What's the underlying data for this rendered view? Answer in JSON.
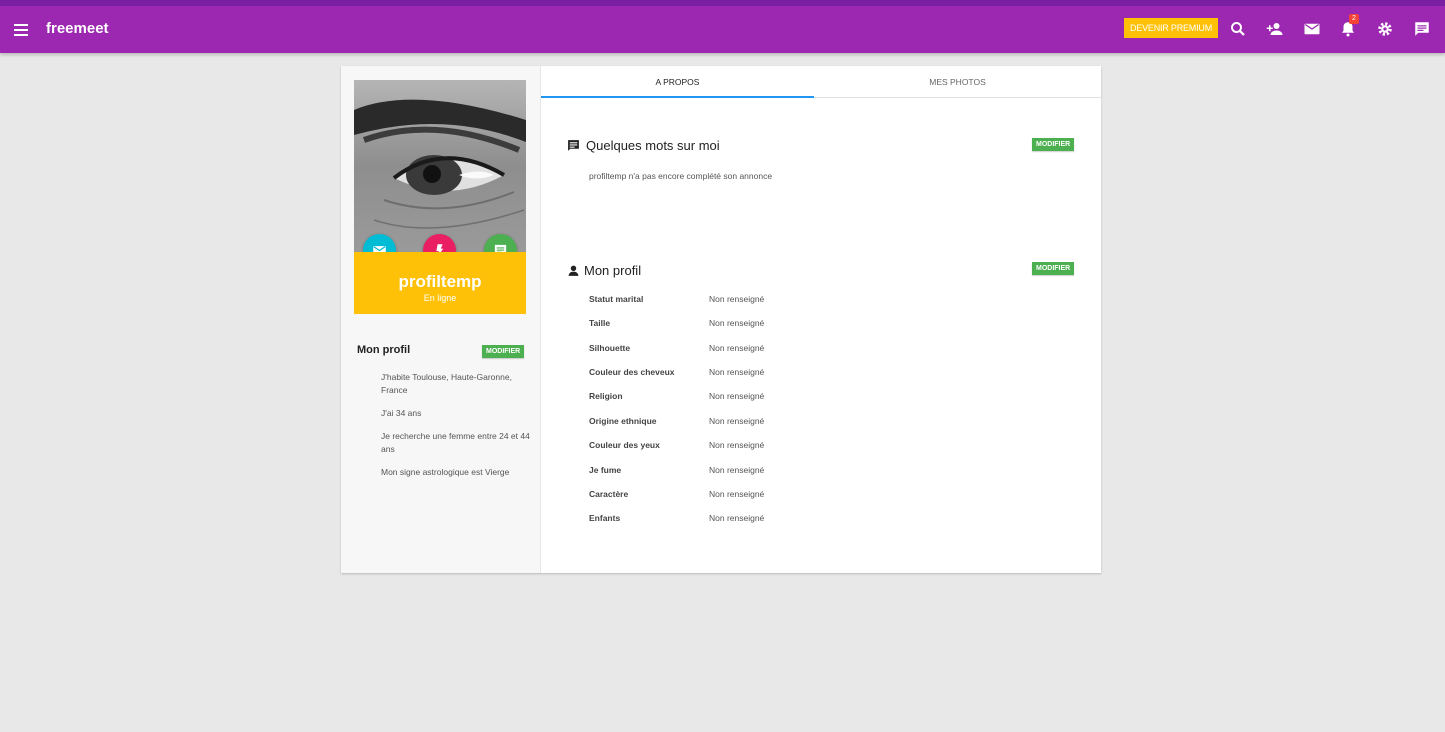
{
  "app": {
    "brand": "freemeet"
  },
  "topbar": {
    "premium_label": "DEVENIR PREMIUM",
    "icons": [
      "search-icon",
      "add-user-icon",
      "mail-icon",
      "bell-icon",
      "gear-icon",
      "chat-icon"
    ],
    "notification_count": "2",
    "colors": {
      "bar": "#9c27b0",
      "premium": "#ffc107",
      "badge": "#f44336"
    }
  },
  "profile": {
    "username": "profiltemp",
    "status": "En ligne",
    "actions": [
      "mail-icon",
      "flash-icon",
      "message-icon"
    ]
  },
  "left_panel": {
    "title": "Mon profil",
    "modify_label": "MODIFIER",
    "facts": [
      "J'habite Toulouse, Haute-Garonne, France",
      "J'ai 34 ans",
      "Je recherche une femme entre 24 et 44 ans",
      "Mon signe astrologique est Vierge"
    ]
  },
  "tabs": [
    {
      "label": "A PROPOS",
      "active": true
    },
    {
      "label": "MES PHOTOS",
      "active": false
    }
  ],
  "about": {
    "title": "Quelques mots sur moi",
    "modify_label": "MODIFIER",
    "text": "profiltemp n'a pas encore complété son annonce"
  },
  "details": {
    "title": "Mon profil",
    "modify_label": "MODIFIER",
    "rows": [
      {
        "label": "Statut marital",
        "value": "Non renseigné"
      },
      {
        "label": "Taille",
        "value": "Non renseigné"
      },
      {
        "label": "Silhouette",
        "value": "Non renseigné"
      },
      {
        "label": "Couleur des cheveux",
        "value": "Non renseigné"
      },
      {
        "label": "Religion",
        "value": "Non renseigné"
      },
      {
        "label": "Origine ethnique",
        "value": "Non renseigné"
      },
      {
        "label": "Couleur des yeux",
        "value": "Non renseigné"
      },
      {
        "label": "Je fume",
        "value": "Non renseigné"
      },
      {
        "label": "Caractère",
        "value": "Non renseigné"
      },
      {
        "label": "Enfants",
        "value": "Non renseigné"
      }
    ]
  }
}
